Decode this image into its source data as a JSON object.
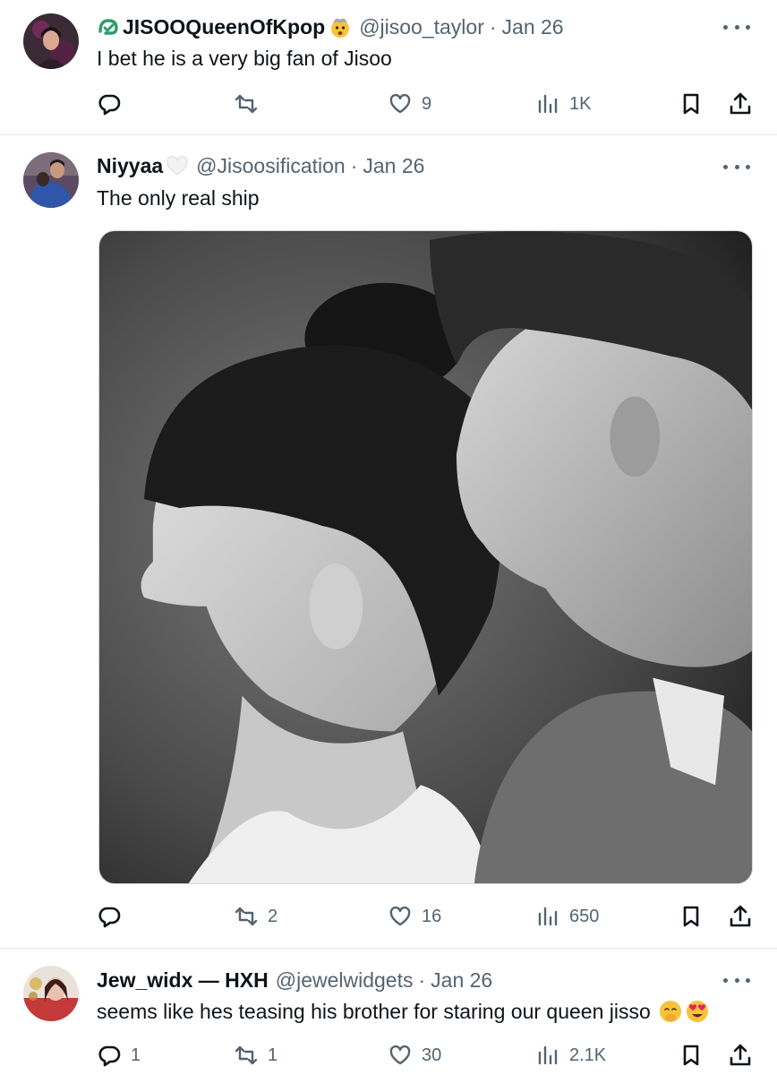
{
  "tweets": [
    {
      "display_name": "JISOOQueenOfKpop",
      "name_suffix_emoji": "🤯",
      "handle": "@jisoo_taylor",
      "separator": "·",
      "date": "Jan 26",
      "text": "I bet he is a very big fan of Jisoo",
      "actions": {
        "reply": "",
        "retweet": "",
        "like": "9",
        "views": "1K"
      }
    },
    {
      "display_name": "Niyyaa",
      "name_suffix_emoji": "🤍",
      "handle": "@Jisoosification",
      "separator": "·",
      "date": "Jan 26",
      "text": "The only real ship",
      "actions": {
        "reply": "",
        "retweet": "2",
        "like": "16",
        "views": "650"
      }
    },
    {
      "display_name": "Jew_widx — HXH",
      "handle": "@jewelwidgets",
      "separator": "·",
      "date": "Jan 26",
      "text": "seems like hes teasing his brother for staring our queen jisso",
      "text_emojis": [
        "🤭",
        "😍"
      ],
      "actions": {
        "reply": "1",
        "retweet": "1",
        "like": "30",
        "views": "2.1K"
      }
    }
  ],
  "icons": {
    "reply": "reply-icon",
    "retweet": "retweet-icon",
    "like": "heart-icon",
    "views": "views-icon",
    "bookmark": "bookmark-icon",
    "share": "share-icon",
    "more": "more-icon",
    "verified": "badge-icon"
  },
  "colors": {
    "text": "#0f1419",
    "secondary": "#536471",
    "divider": "#e7e9ea",
    "badge_green": "#2e9c6a"
  }
}
